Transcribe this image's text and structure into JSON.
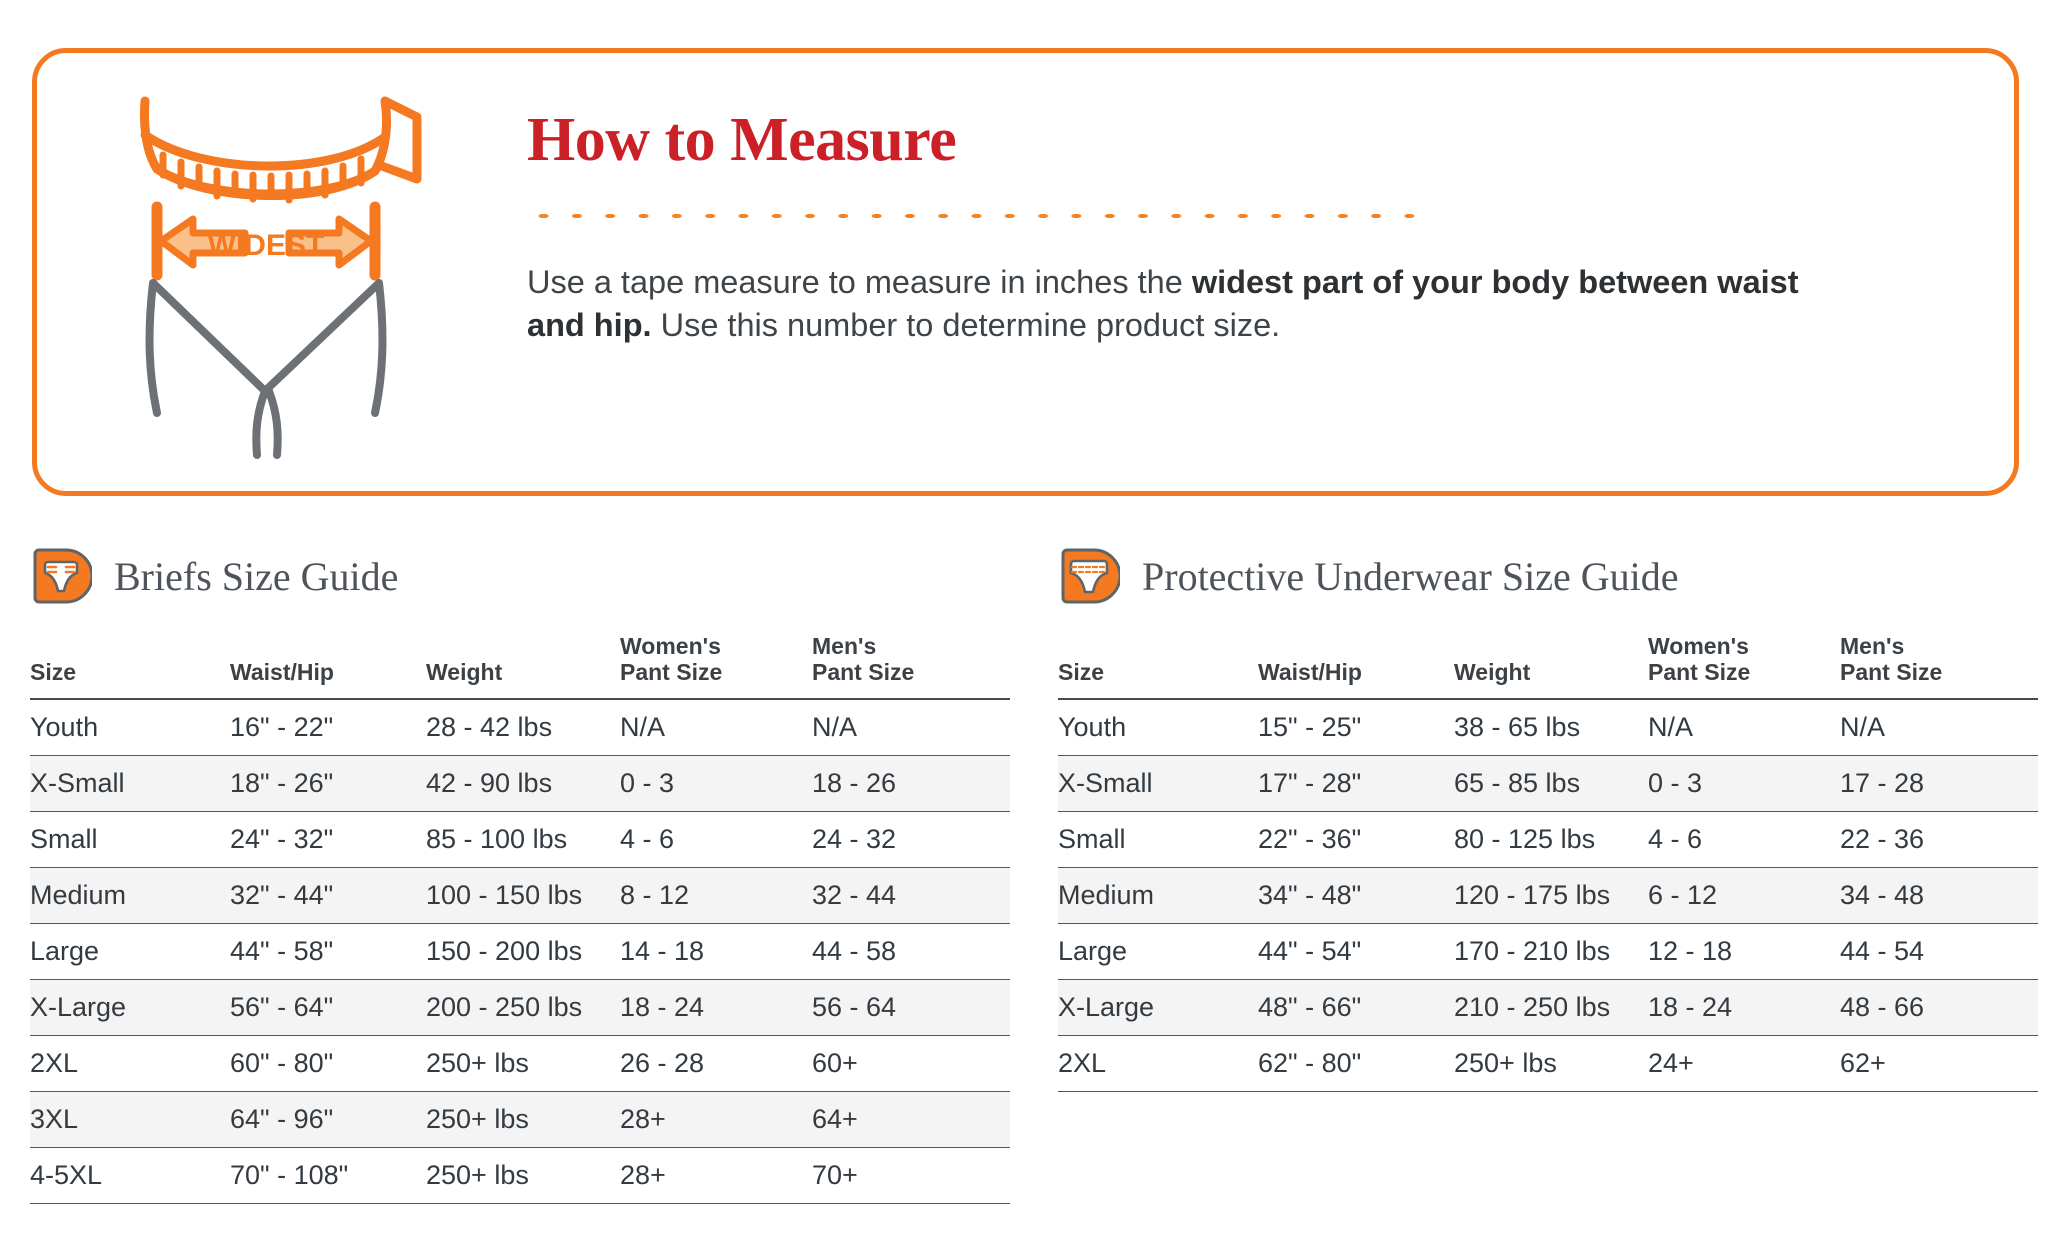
{
  "measure_panel": {
    "title": "How to Measure",
    "illustration_label": "WIDEST",
    "body_lead": "Use a tape measure to measure in inches the ",
    "body_bold": "widest part of your body between waist and hip.",
    "body_tail": " Use this number to determine product size.",
    "accent_color": "#F47920",
    "title_color": "#CB2027"
  },
  "guides": [
    {
      "title": "Briefs Size Guide",
      "icon": "brief-icon",
      "columns": [
        "Size",
        "Waist/Hip",
        "Weight",
        "Women's\nPant Size",
        "Men's\nPant Size"
      ],
      "columns_flat": [
        "Size",
        "Waist/Hip",
        "Weight",
        "Women's Pant Size",
        "Men's Pant Size"
      ],
      "rows": [
        [
          "Youth",
          "16\" - 22\"",
          "28 - 42 lbs",
          "N/A",
          "N/A"
        ],
        [
          "X-Small",
          "18\" - 26\"",
          "42 - 90 lbs",
          "0 - 3",
          "18 - 26"
        ],
        [
          "Small",
          "24\" - 32\"",
          "85 - 100 lbs",
          "4 - 6",
          "24 - 32"
        ],
        [
          "Medium",
          "32\" - 44\"",
          "100 - 150 lbs",
          "8 - 12",
          "32 - 44"
        ],
        [
          "Large",
          "44\" - 58\"",
          "150 - 200 lbs",
          "14 - 18",
          "44 - 58"
        ],
        [
          "X-Large",
          "56\" - 64\"",
          "200 - 250 lbs",
          "18 - 24",
          "56 - 64"
        ],
        [
          "2XL",
          "60\" - 80\"",
          "250+ lbs",
          "26 - 28",
          "60+"
        ],
        [
          "3XL",
          "64\" - 96\"",
          "250+ lbs",
          "28+",
          "64+"
        ],
        [
          "4-5XL",
          "70\" - 108\"",
          "250+ lbs",
          "28+",
          "70+"
        ]
      ]
    },
    {
      "title": "Protective Underwear Size Guide",
      "icon": "protective-underwear-icon",
      "columns": [
        "Size",
        "Waist/Hip",
        "Weight",
        "Women's\nPant Size",
        "Men's\nPant Size"
      ],
      "columns_flat": [
        "Size",
        "Waist/Hip",
        "Weight",
        "Women's Pant Size",
        "Men's Pant Size"
      ],
      "rows": [
        [
          "Youth",
          "15\" - 25\"",
          "38 - 65 lbs",
          "N/A",
          "N/A"
        ],
        [
          "X-Small",
          "17\" - 28\"",
          "65 - 85 lbs",
          "0 - 3",
          "17 - 28"
        ],
        [
          "Small",
          "22\" - 36\"",
          "80 - 125 lbs",
          "4 - 6",
          "22 - 36"
        ],
        [
          "Medium",
          "34\" - 48\"",
          "120 - 175 lbs",
          "6 - 12",
          "34 - 48"
        ],
        [
          "Large",
          "44\" - 54\"",
          "170 - 210 lbs",
          "12 - 18",
          "44 - 54"
        ],
        [
          "X-Large",
          "48\" - 66\"",
          "210 - 250 lbs",
          "18 - 24",
          "48 - 66"
        ],
        [
          "2XL",
          "62\" - 80\"",
          "250+ lbs",
          "24+",
          "62+"
        ]
      ]
    }
  ]
}
